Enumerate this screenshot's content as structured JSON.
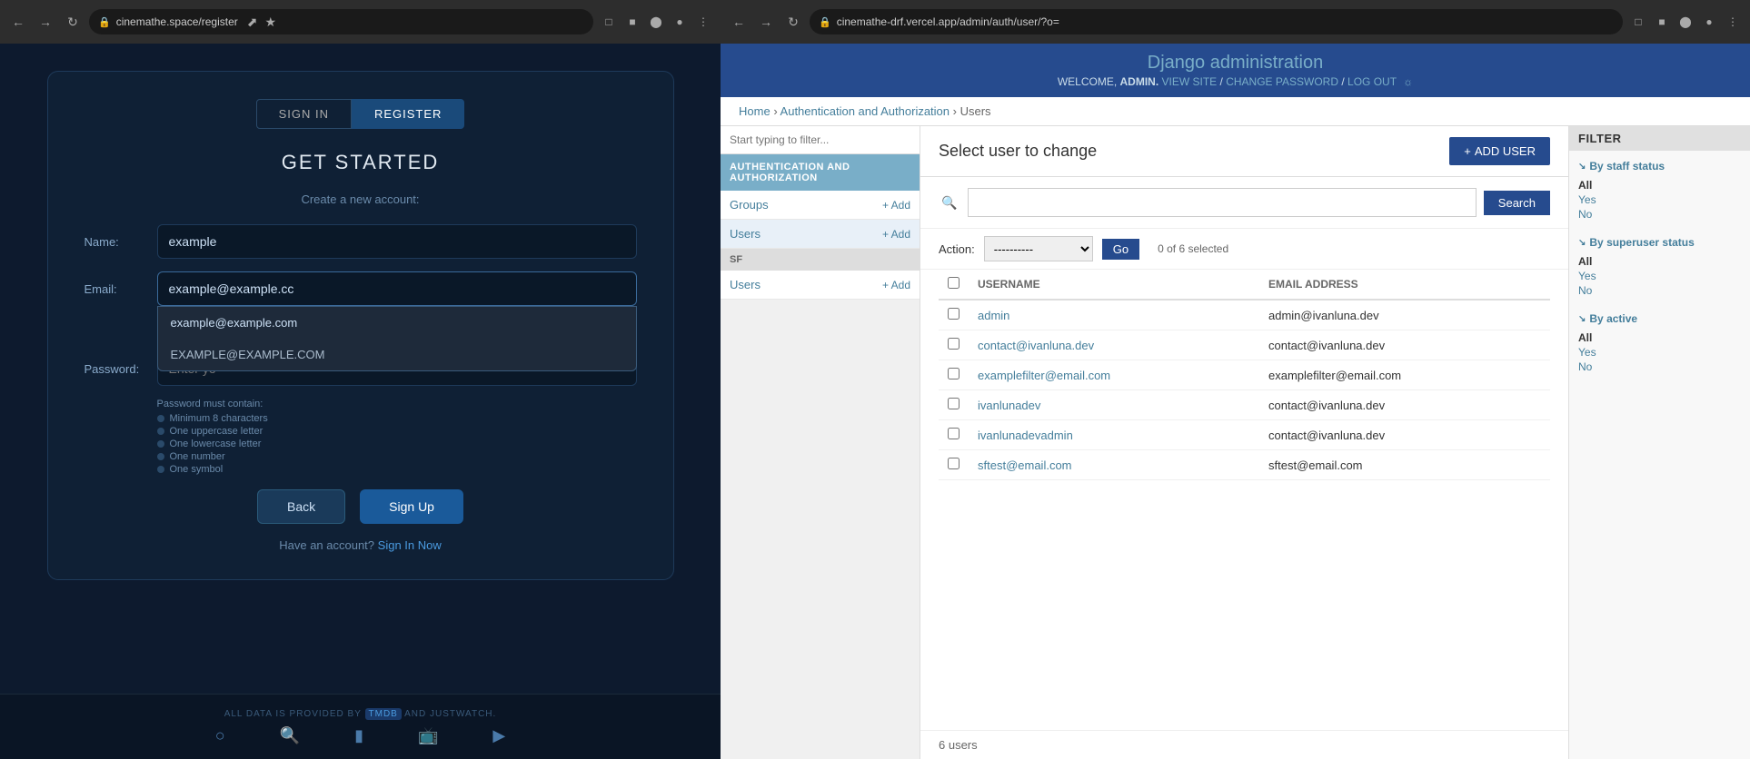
{
  "left": {
    "browser": {
      "url": "cinemathe.space/register",
      "title": "cinemathe.space/register"
    },
    "tabs": {
      "signin": "SIGN IN",
      "register": "REGISTER"
    },
    "form": {
      "title": "Get started",
      "subtitle": "Create a new account:",
      "name_label": "Name:",
      "name_value": "example",
      "email_label": "Email:",
      "email_value": "example@example.cc",
      "password_label": "Password:",
      "password_placeholder": "Enter yo",
      "password_hint": "Password must contain:",
      "requirements": [
        "Minimum 8 characters",
        "One uppercase letter",
        "One lowercase letter",
        "One number",
        "One symbol"
      ],
      "autocomplete": {
        "item1": "example@example.com",
        "item2": "EXAMPLE@EXAMPLE.COM"
      },
      "back_btn": "Back",
      "signup_btn": "Sign Up",
      "footer": "Have an account?",
      "signin_link": "Sign In Now"
    },
    "bottom": {
      "credit": "ALL DATA IS PROVIDED BY TMDB   AND JUSTWATCH.",
      "tmdb": "TMDB",
      "justwatch": "JUSTWATCH"
    }
  },
  "right": {
    "browser": {
      "url": "cinemathe-drf.vercel.app/admin/auth/user/?o="
    },
    "header": {
      "title_django": "Django",
      "title_admin": " administration",
      "welcome": "WELCOME,",
      "user": "ADMIN.",
      "view_site": "VIEW SITE",
      "change_password": "CHANGE PASSWORD",
      "logout": "LOG OUT"
    },
    "breadcrumb": {
      "home": "Home",
      "auth": "Authentication and Authorization",
      "users": "Users"
    },
    "sidebar": {
      "filter_placeholder": "Start typing to filter...",
      "section_header": "AUTHENTICATION AND AUTHORIZATION",
      "items": [
        {
          "label": "Groups",
          "add": "+ Add"
        },
        {
          "label": "Users",
          "add": "+ Add"
        }
      ],
      "sf_header": "SF",
      "sf_items": [
        {
          "label": "Users",
          "add": "+ Add"
        }
      ]
    },
    "content": {
      "title": "Select user to change",
      "add_user_btn": "ADD USER",
      "add_user_plus": "+",
      "search_placeholder": "",
      "search_btn": "Search",
      "action_label": "Action:",
      "action_default": "----------",
      "go_btn": "Go",
      "selected_text": "0 of 6 selected",
      "table": {
        "headers": [
          "USERNAME",
          "EMAIL ADDRESS"
        ],
        "rows": [
          {
            "username": "admin",
            "email": "admin@ivanluna.dev"
          },
          {
            "username": "contact@ivanluna.dev",
            "email": "contact@ivanluna.dev"
          },
          {
            "username": "examplefilter@email.com",
            "email": "examplefilter@email.com"
          },
          {
            "username": "ivanlunadev",
            "email": "contact@ivanluna.dev"
          },
          {
            "username": "ivanlunadevadmin",
            "email": "contact@ivanluna.dev"
          },
          {
            "username": "sftest@email.com",
            "email": "sftest@email.com"
          }
        ]
      },
      "user_count": "6 users"
    },
    "filter": {
      "title": "FILTER",
      "sections": [
        {
          "title": "By staff status",
          "options": [
            "All",
            "Yes",
            "No"
          ]
        },
        {
          "title": "By superuser status",
          "options": [
            "All",
            "Yes",
            "No"
          ]
        },
        {
          "title": "By active",
          "options": [
            "All",
            "Yes",
            "No"
          ]
        }
      ]
    }
  }
}
